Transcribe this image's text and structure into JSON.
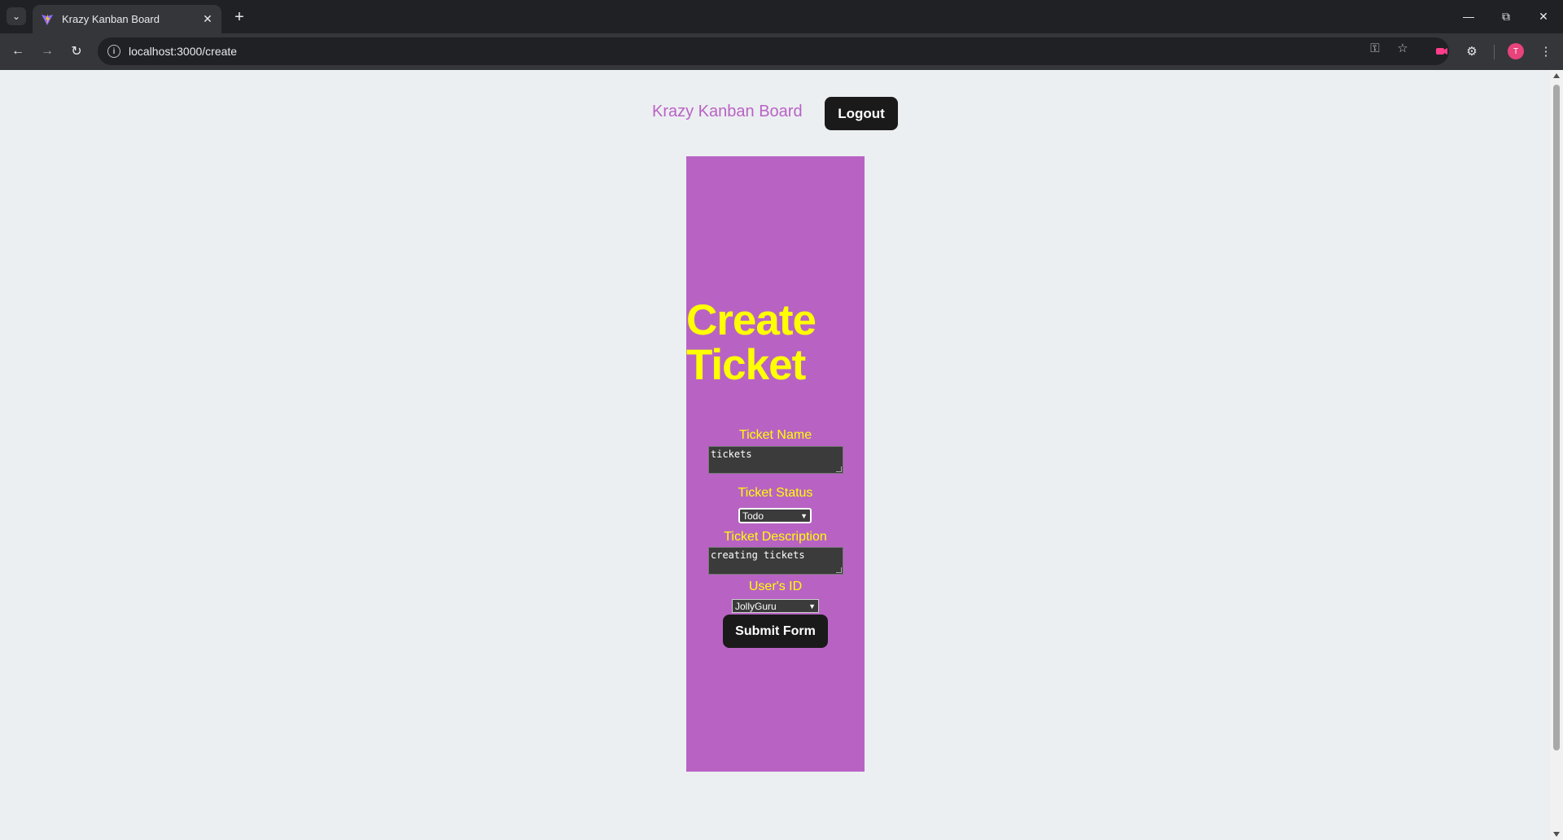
{
  "browser": {
    "tab_title": "Krazy Kanban Board",
    "url": "localhost:3000/create",
    "profile_initial": "T"
  },
  "header": {
    "brand": "Krazy Kanban Board",
    "logout_label": "Logout"
  },
  "form": {
    "title": "Create Ticket",
    "name_label": "Ticket Name",
    "name_value": "tickets",
    "status_label": "Ticket Status",
    "status_value": "Todo",
    "description_label": "Ticket Description",
    "description_value": "creating tickets",
    "user_label": "User's ID",
    "user_value": "JollyGuru",
    "submit_label": "Submit Form"
  },
  "colors": {
    "panel": "#b863c4",
    "title_text": "#ffff00",
    "brand_text": "#b863c4",
    "button_bg": "#1a1a1a",
    "page_bg": "#eceff1"
  }
}
